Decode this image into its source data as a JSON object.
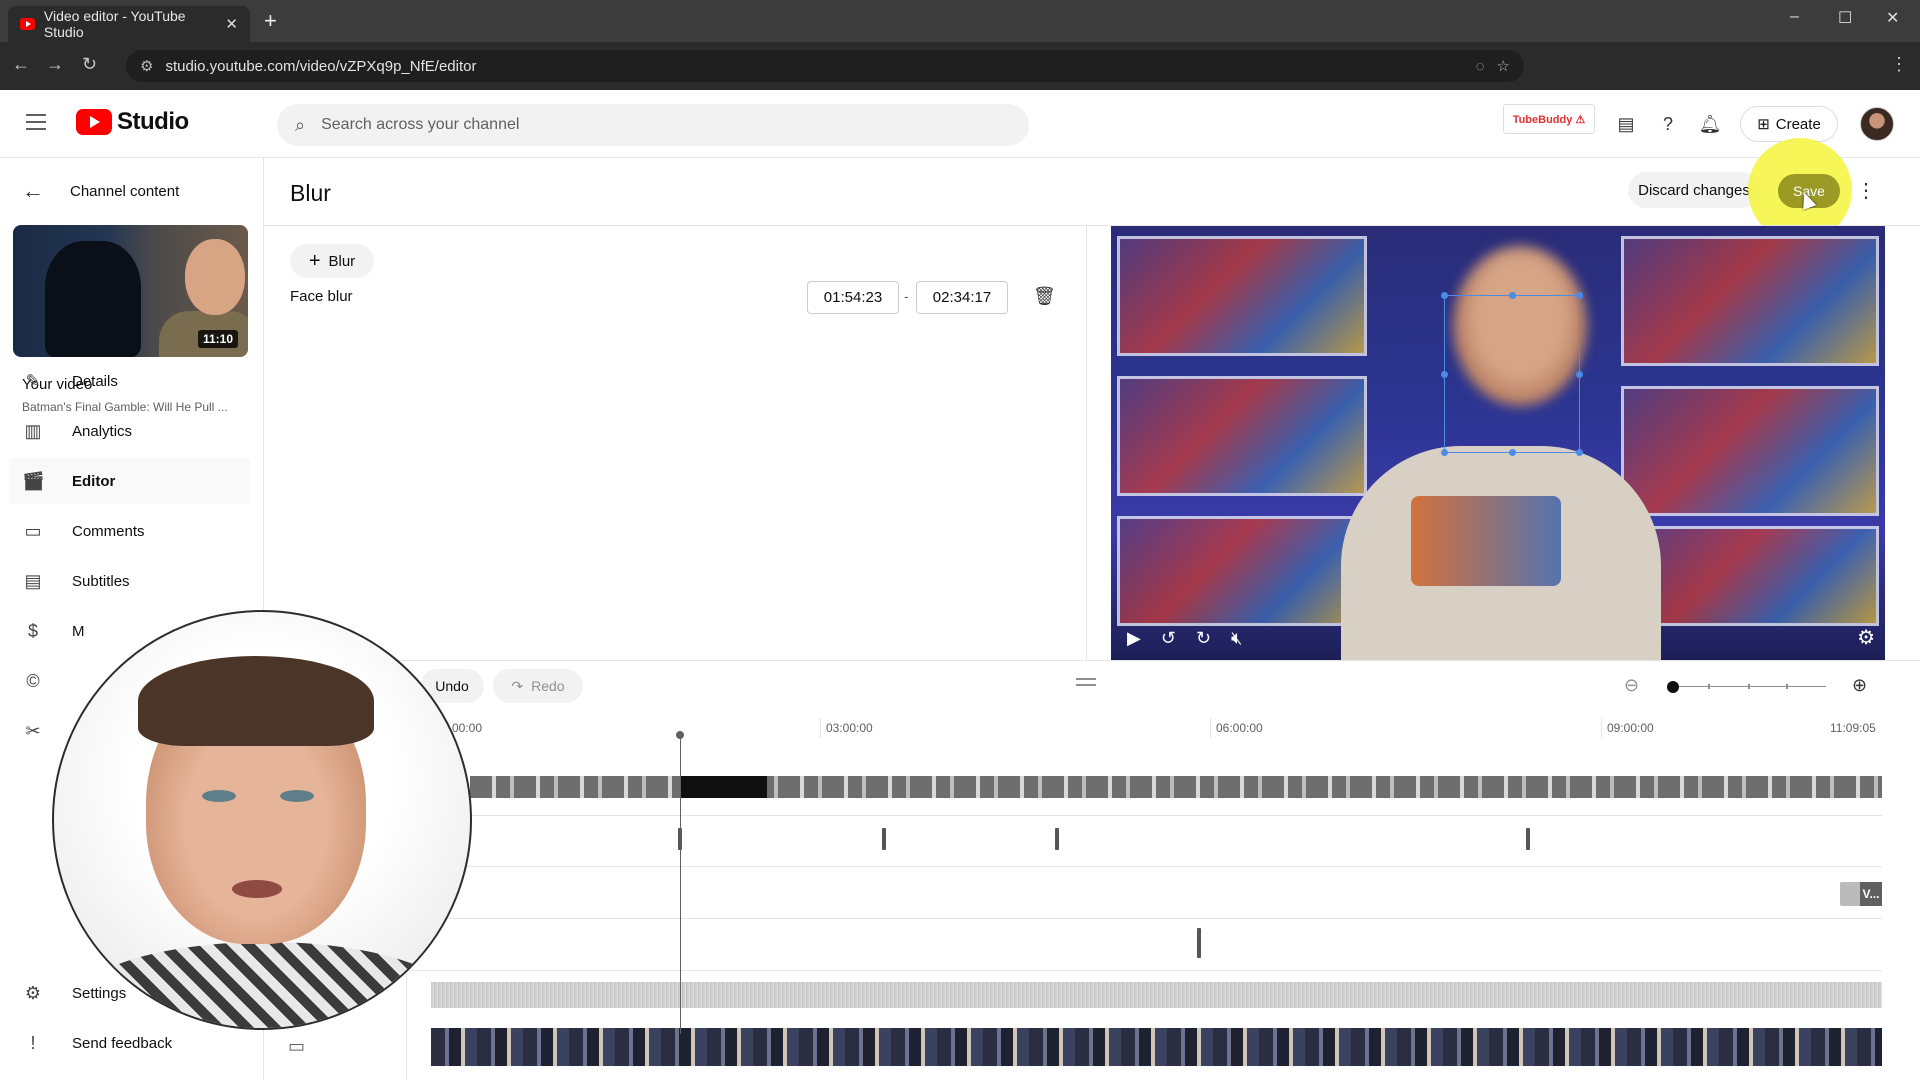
{
  "browser": {
    "tab_title": "Video editor - YouTube Studio",
    "tab_close": "✕",
    "new_tab": "+",
    "url": "studio.youtube.com/video/vZPXq9p_NfE/editor",
    "controls": {
      "minimize": "–",
      "maximize": "☐",
      "close": "✕"
    },
    "icons": [
      "back-icon",
      "forward-icon",
      "reload-icon",
      "site-settings-icon",
      "eye-off-icon",
      "bookmark-star-icon",
      "extensions-icon",
      "menu-dots-icon"
    ]
  },
  "header": {
    "logo_text": "Studio",
    "search_placeholder": "Search across your channel",
    "tubebuddy_label": "TubeBuddy ⚠",
    "create_label": "Create"
  },
  "sidebar": {
    "back_label": "Channel content",
    "thumbnail_duration": "11:10",
    "your_video_label": "Your video",
    "video_title": "Batman's Final Gamble: Will He Pull ...",
    "items": [
      {
        "label": "Details",
        "icon": "pencil-icon"
      },
      {
        "label": "Analytics",
        "icon": "analytics-icon"
      },
      {
        "label": "Editor",
        "icon": "editor-icon",
        "active": true
      },
      {
        "label": "Comments",
        "icon": "comments-icon"
      },
      {
        "label": "Subtitles",
        "icon": "subtitles-icon"
      },
      {
        "label": "M",
        "icon": "monetization-icon"
      },
      {
        "label": "",
        "icon": "copyright-icon"
      },
      {
        "label": "",
        "icon": "scissors-icon"
      }
    ],
    "settings_label": "Settings",
    "feedback_label": "Send feedback"
  },
  "editor": {
    "title": "Blur",
    "discard_label": "Discard changes",
    "save_label": "Save",
    "add_blur_label": "Blur",
    "blur_item_label": "Face blur",
    "start_time": "01:54:23",
    "time_separator": "-",
    "end_time": "02:34:17"
  },
  "timeline": {
    "undo_label": "Undo",
    "redo_label": "Redo",
    "ruler": [
      "00:00:00",
      "03:00:00",
      "06:00:00",
      "09:00:00",
      "11:09:05"
    ],
    "ruler_first_visible": "00:00",
    "end_tag": "V..."
  },
  "colors": {
    "accent_red": "#ff0000",
    "save_highlight": "#f5f53c",
    "blur_box": "#4a8be8"
  }
}
